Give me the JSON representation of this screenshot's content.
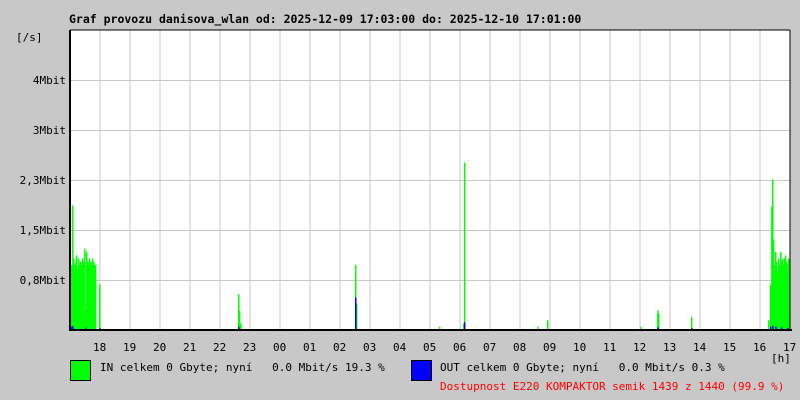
{
  "title": "Graf provozu danisova_wlan od: 2025-12-09 17:03:00 do: 2025-12-10 17:01:00",
  "chart_data": {
    "type": "bar",
    "title": "Graf provozu danisova_wlan od: 2025-12-09 17:03:00 do: 2025-12-10 17:01:00",
    "ylabel": "[/s]",
    "xlabel": "[h]",
    "ylim": [
      0,
      4.62
    ],
    "xlim_hours": [
      0,
      24
    ],
    "y_ticks": [
      {
        "v": 0.77,
        "label": "0,8Mbit"
      },
      {
        "v": 1.54,
        "label": "1,5Mbit"
      },
      {
        "v": 2.31,
        "label": "2,3Mbit"
      },
      {
        "v": 3.08,
        "label": "3Mbit"
      },
      {
        "v": 3.85,
        "label": "4Mbit"
      }
    ],
    "x_ticks": [
      "18",
      "19",
      "20",
      "21",
      "22",
      "23",
      "00",
      "01",
      "02",
      "03",
      "04",
      "05",
      "06",
      "07",
      "08",
      "09",
      "10",
      "11",
      "12",
      "13",
      "14",
      "15",
      "16",
      "17"
    ],
    "grid": true,
    "series": [
      {
        "name": "IN",
        "color": "#00ff00",
        "points": [
          [
            0.03,
            1.0
          ],
          [
            0.07,
            1.92
          ],
          [
            0.1,
            1.1
          ],
          [
            0.13,
            1.0
          ],
          [
            0.17,
            1.05
          ],
          [
            0.2,
            1.15
          ],
          [
            0.23,
            0.95
          ],
          [
            0.27,
            1.1
          ],
          [
            0.3,
            1.0
          ],
          [
            0.33,
            1.05
          ],
          [
            0.37,
            1.0
          ],
          [
            0.4,
            1.1
          ],
          [
            0.43,
            1.05
          ],
          [
            0.47,
            1.25
          ],
          [
            0.5,
            0.3
          ],
          [
            0.53,
            1.2
          ],
          [
            0.57,
            1.05
          ],
          [
            0.6,
            1.0
          ],
          [
            0.63,
            1.1
          ],
          [
            0.67,
            1.05
          ],
          [
            0.7,
            1.0
          ],
          [
            0.73,
            1.1
          ],
          [
            0.77,
            1.05
          ],
          [
            0.8,
            1.0
          ],
          [
            0.83,
            1.0
          ],
          [
            0.97,
            0.7
          ],
          [
            5.6,
            0.55
          ],
          [
            5.63,
            0.3
          ],
          [
            5.67,
            0.1
          ],
          [
            9.5,
            1.0
          ],
          [
            9.53,
            0.4
          ],
          [
            12.3,
            0.05
          ],
          [
            13.1,
            0.1
          ],
          [
            13.13,
            2.58
          ],
          [
            15.57,
            0.05
          ],
          [
            15.9,
            0.15
          ],
          [
            19.0,
            0.05
          ],
          [
            19.57,
            0.3
          ],
          [
            19.6,
            0.25
          ],
          [
            20.7,
            0.2
          ],
          [
            23.27,
            0.15
          ],
          [
            23.33,
            0.7
          ],
          [
            23.37,
            1.9
          ],
          [
            23.4,
            2.32
          ],
          [
            23.43,
            1.4
          ],
          [
            23.47,
            1.0
          ],
          [
            23.5,
            1.2
          ],
          [
            23.53,
            1.05
          ],
          [
            23.57,
            0.9
          ],
          [
            23.6,
            1.1
          ],
          [
            23.63,
            1.0
          ],
          [
            23.67,
            1.2
          ],
          [
            23.7,
            1.05
          ],
          [
            23.73,
            1.1
          ],
          [
            23.77,
            1.0
          ],
          [
            23.8,
            1.1
          ],
          [
            23.83,
            1.15
          ],
          [
            23.87,
            1.05
          ],
          [
            23.9,
            1.0
          ],
          [
            23.93,
            1.1
          ],
          [
            23.97,
            0.3
          ]
        ]
      },
      {
        "name": "OUT",
        "color": "#0000ff",
        "points": [
          [
            0.03,
            0.05
          ],
          [
            0.07,
            0.06
          ],
          [
            0.5,
            0.04
          ],
          [
            0.97,
            0.03
          ],
          [
            5.6,
            0.05
          ],
          [
            9.5,
            0.5
          ],
          [
            13.13,
            0.12
          ],
          [
            19.57,
            0.04
          ],
          [
            20.7,
            0.03
          ],
          [
            23.33,
            0.05
          ],
          [
            23.4,
            0.06
          ],
          [
            23.5,
            0.05
          ],
          [
            23.7,
            0.04
          ],
          [
            23.9,
            0.03
          ]
        ]
      }
    ]
  },
  "legend": {
    "in": "IN celkem 0 Gbyte; nyní   0.0 Mbit/s 19.3 %",
    "out": "OUT celkem 0 Gbyte; nyní   0.0 Mbit/s 0.3 %",
    "availability": "Dostupnost E220 KOMPAKTOR semik 1439 z 1440 (99.9 %)",
    "availability_color": "#ff0000"
  }
}
